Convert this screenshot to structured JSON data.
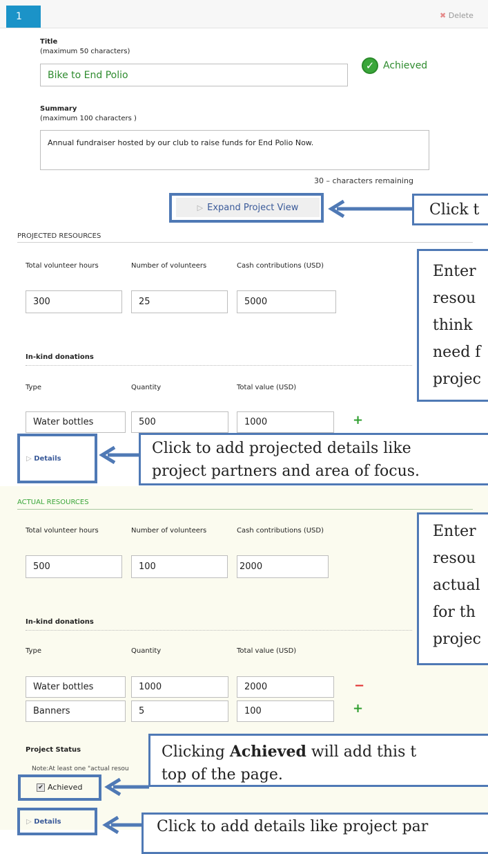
{
  "header": {
    "number": "1",
    "delete_label": "Delete"
  },
  "title_section": {
    "label": "Title",
    "hint": "(maximum 50 characters)",
    "value": "Bike to End Polio",
    "status": "Achieved"
  },
  "summary_section": {
    "label": "Summary",
    "hint": "(maximum 100 characters )",
    "value": "Annual fundraiser hosted by our club to raise funds for End Polio Now.",
    "remaining": "30 – characters remaining"
  },
  "expand_label": "Expand Project View",
  "projected": {
    "heading": "PROJECTED RESOURCES",
    "col_hours": "Total volunteer hours",
    "col_volunteers": "Number of volunteers",
    "col_cash": "Cash contributions (USD)",
    "hours": "300",
    "volunteers": "25",
    "cash": "5000",
    "inkind_heading": "In-kind donations",
    "col_type": "Type",
    "col_qty": "Quantity",
    "col_value": "Total value (USD)",
    "rows": [
      {
        "type": "Water bottles",
        "qty": "500",
        "value": "1000"
      }
    ],
    "details_label": "Details"
  },
  "actual": {
    "heading": "ACTUAL RESOURCES",
    "col_hours": "Total volunteer hours",
    "col_volunteers": "Number of volunteers",
    "col_cash": "Cash contributions (USD)",
    "hours": "500",
    "volunteers": "100",
    "cash": "2000",
    "inkind_heading": "In-kind donations",
    "col_type": "Type",
    "col_qty": "Quantity",
    "col_value": "Total value (USD)",
    "rows": [
      {
        "type": "Water bottles",
        "qty": "1000",
        "value": "2000"
      },
      {
        "type": "Banners",
        "qty": "5",
        "value": "100"
      }
    ]
  },
  "project_status": {
    "heading": "Project Status",
    "note": "Note:At least one \"actual resou",
    "achieved_label": "Achieved",
    "details_label": "Details"
  },
  "callouts": {
    "expand": "Click t",
    "projected_lines": [
      "Enter",
      "resou",
      "think",
      "need f",
      "projec"
    ],
    "projected_details_lines": [
      "Click to add projected details like",
      "project partners and area of focus."
    ],
    "actual_lines": [
      "Enter",
      "resou",
      "actual",
      "for th",
      "projec"
    ],
    "achieved_line1_pre": "Clicking ",
    "achieved_line1_bold": "Achieved",
    "achieved_line1_post": " will add this t",
    "achieved_line2": "top of the page.",
    "details_bottom": "Click to add details like project par"
  },
  "colors": {
    "accent": "#1b93c8",
    "callout_border": "#4f79b5",
    "achieved_green": "#3aa63a",
    "actual_bg": "#fbfbef"
  }
}
